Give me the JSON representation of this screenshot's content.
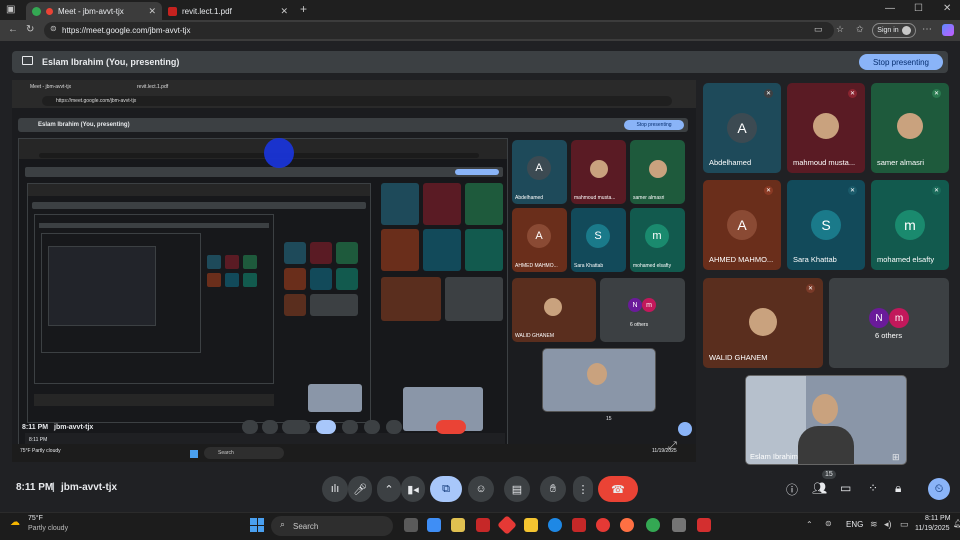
{
  "browser": {
    "tabs": [
      {
        "title": "Meet - jbm-avvt-tjx"
      },
      {
        "title": "revit.lect.1.pdf"
      }
    ],
    "url": "https://meet.google.com/jbm-avvt-tjx",
    "signin_label": "Sign in"
  },
  "presenting": {
    "title": "Eslam Ibrahim (You, presenting)",
    "stop_label": "Stop presenting"
  },
  "shared_screen": {
    "url": "https://meet.google.com/jbm-avvt-tjx",
    "tabs": [
      "Meet - jbm-avvt-tjx",
      "revit.lect.1.pdf"
    ],
    "presenting_title": "Eslam Ibrahim (You, presenting)",
    "stop_label": "Stop presenting",
    "time": "8:11 PM",
    "meeting_code": "jbm-avvt-tjx",
    "weather": "75°F Partly cloudy",
    "participant_count": "15",
    "date": "11/19/2025",
    "search": "Search"
  },
  "participants": [
    {
      "name": "Abdelhamed",
      "initial": "A",
      "color": "#1e4a5a",
      "avatar_color": "#3c4a52"
    },
    {
      "name": "mahmoud musta...",
      "initial": "",
      "color": "#5a1b24",
      "avatar_color": "#c9a27e"
    },
    {
      "name": "samer almasri",
      "initial": "",
      "color": "#1e5a3c",
      "avatar_color": "#c9a27e"
    },
    {
      "name": "AHMED MAHMO...",
      "initial": "A",
      "color": "#6a2e1b",
      "avatar_color": "#8a4a34"
    },
    {
      "name": "Sara Khattab",
      "initial": "S",
      "color": "#124a5a",
      "avatar_color": "#1a7a8a"
    },
    {
      "name": "mohamed elsafty",
      "initial": "m",
      "color": "#125a4e",
      "avatar_color": "#1a8a6e"
    },
    {
      "name": "WALID GHANEM",
      "initial": "",
      "color": "#5a2e1e",
      "avatar_color": "#c9a27e"
    },
    {
      "name": "6 others",
      "initial_1": "N",
      "initial_2": "m",
      "color": "#3c4043"
    },
    {
      "name": "Eslam Ibrahim",
      "initial": "",
      "color": "#8a96a8"
    }
  ],
  "meeting": {
    "time": "8:11 PM",
    "code": "jbm-avvt-tjx",
    "participant_count": "15"
  },
  "taskbar": {
    "weather_temp": "75°F",
    "weather_desc": "Partly cloudy",
    "search_label": "Search",
    "lang": "ENG",
    "time": "8:11 PM",
    "date": "11/19/2025"
  },
  "colors": {
    "accent": "#8ab4f8",
    "end_call": "#ea4335",
    "present_active": "#a8c7fa",
    "background": "#202124"
  }
}
